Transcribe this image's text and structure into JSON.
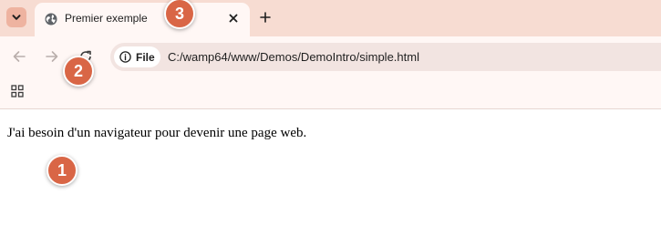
{
  "tab": {
    "title": "Premier exemple"
  },
  "address_bar": {
    "chip_label": "File",
    "url": "C:/wamp64/www/Demos/DemoIntro/simple.html"
  },
  "page": {
    "text": "J'ai besoin d'un navigateur pour devenir une page web."
  },
  "annotations": [
    {
      "label": "1"
    },
    {
      "label": "2"
    },
    {
      "label": "3"
    }
  ],
  "colors": {
    "tabbar_bg": "#f7dcd2",
    "toolbar_bg": "#fff7f5",
    "omnibox_bg": "#f2e4e1",
    "badge": "#d96646"
  },
  "icons": {
    "tab_menu": "chevron-down-icon",
    "favicon": "globe-icon",
    "close": "close-icon",
    "new_tab": "plus-icon",
    "back": "arrow-left-icon",
    "forward": "arrow-right-icon",
    "reload": "reload-icon",
    "site_info": "info-icon",
    "apps": "apps-grid-icon"
  }
}
